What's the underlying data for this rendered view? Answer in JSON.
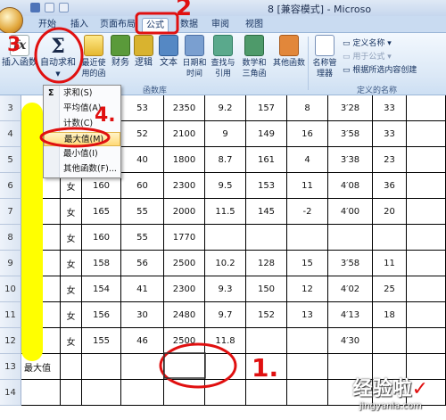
{
  "titlebar": {
    "title": "8 [兼容模式] - Microso"
  },
  "tabs": [
    {
      "label": "开始"
    },
    {
      "label": "插入"
    },
    {
      "label": "页面布局"
    },
    {
      "label": "公式"
    },
    {
      "label": "数据"
    },
    {
      "label": "审阅"
    },
    {
      "label": "视图"
    }
  ],
  "ribbon": {
    "insert_function": "插入函数",
    "autosum": "自动求和",
    "recent": "最近使用的函数",
    "financial": "财务",
    "logical": "逻辑",
    "text": "文本",
    "datetime": "日期和时间",
    "lookup": "查找与引用",
    "math": "数学和三角函数",
    "other": "其他函数",
    "name_manager": "名称管理器",
    "define_name": "定义名称",
    "use_in_formula": "用于公式",
    "create_from_selection": "根据所选内容创建",
    "group_library": "函数库",
    "group_names": "定义的名称"
  },
  "menu": {
    "items": [
      {
        "label": "求和(S)"
      },
      {
        "label": "平均值(A)"
      },
      {
        "label": "计数(C)"
      },
      {
        "label": "最大值(M)"
      },
      {
        "label": "最小值(I)"
      },
      {
        "label": "其他函数(F)..."
      }
    ]
  },
  "rows": [
    {
      "num": "3",
      "b": "",
      "c": "",
      "d": "53",
      "e": "2350",
      "f": "9.2",
      "g": "157",
      "h": "8",
      "i": "3′28",
      "j": "33"
    },
    {
      "num": "4",
      "b": "",
      "c": "",
      "d": "52",
      "e": "2100",
      "f": "9",
      "g": "149",
      "h": "16",
      "i": "3′58",
      "j": "33"
    },
    {
      "num": "5",
      "b": "",
      "c": "",
      "d": "40",
      "e": "1800",
      "f": "8.7",
      "g": "161",
      "h": "4",
      "i": "3′38",
      "j": "23"
    },
    {
      "num": "6",
      "b": "女",
      "c": "160",
      "d": "60",
      "e": "2300",
      "f": "9.5",
      "g": "153",
      "h": "11",
      "i": "4′08",
      "j": "36"
    },
    {
      "num": "7",
      "b": "女",
      "c": "165",
      "d": "55",
      "e": "2000",
      "f": "11.5",
      "g": "145",
      "h": "-2",
      "i": "4′00",
      "j": "20"
    },
    {
      "num": "8",
      "b": "女",
      "c": "160",
      "d": "55",
      "e": "1770",
      "f": "",
      "g": "",
      "h": "",
      "i": "",
      "j": ""
    },
    {
      "num": "9",
      "b": "女",
      "c": "158",
      "d": "56",
      "e": "2500",
      "f": "10.2",
      "g": "128",
      "h": "15",
      "i": "3′58",
      "j": "11"
    },
    {
      "num": "10",
      "b": "女",
      "c": "154",
      "d": "41",
      "e": "2300",
      "f": "9.3",
      "g": "150",
      "h": "12",
      "i": "4′02",
      "j": "25"
    },
    {
      "num": "11",
      "b": "女",
      "c": "156",
      "d": "30",
      "e": "2480",
      "f": "9.7",
      "g": "152",
      "h": "13",
      "i": "4′13",
      "j": "18"
    },
    {
      "num": "12",
      "b": "女",
      "c": "155",
      "d": "46",
      "e": "2500",
      "f": "11.8",
      "g": "",
      "h": "",
      "i": "4′30",
      "j": ""
    },
    {
      "num": "13",
      "a": "最大值",
      "b": "",
      "c": "",
      "d": "",
      "e": "",
      "f": "",
      "g": "",
      "h": "",
      "i": "",
      "j": ""
    },
    {
      "num": "14",
      "b": "",
      "c": "",
      "d": "",
      "e": "",
      "f": "",
      "g": "",
      "h": "",
      "i": "",
      "j": ""
    }
  ],
  "annotations": {
    "n1": "1.",
    "n2": "2",
    "n3": "3",
    "n4": "4."
  },
  "watermark": {
    "main": "经验啦",
    "sub": "jingyanla.com",
    "check": "✓"
  }
}
